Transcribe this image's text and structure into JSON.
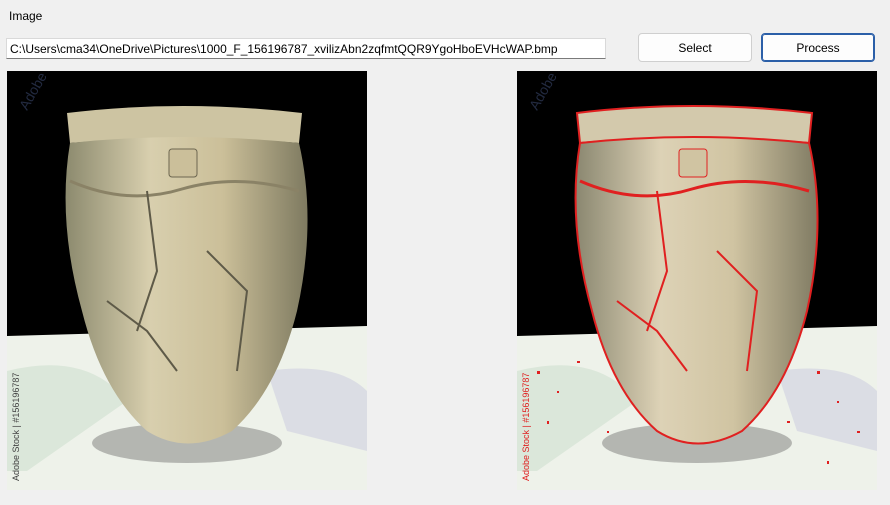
{
  "labels": {
    "image": "Image"
  },
  "path": {
    "value": "C:\\Users\\cma34\\OneDrive\\Pictures\\1000_F_156196787_xvilizAbn2zqfmtQQR9YgoHboEVHcWAP.bmp"
  },
  "buttons": {
    "select": "Select",
    "process": "Process"
  },
  "images": {
    "original": {
      "watermark": "Adobe Stock",
      "stock_id": "Adobe Stock | #156196787"
    },
    "processed": {
      "watermark": "Adobe Stock",
      "stock_id": "Adobe Stock | #156196787",
      "edge_color": "#e02020"
    }
  }
}
